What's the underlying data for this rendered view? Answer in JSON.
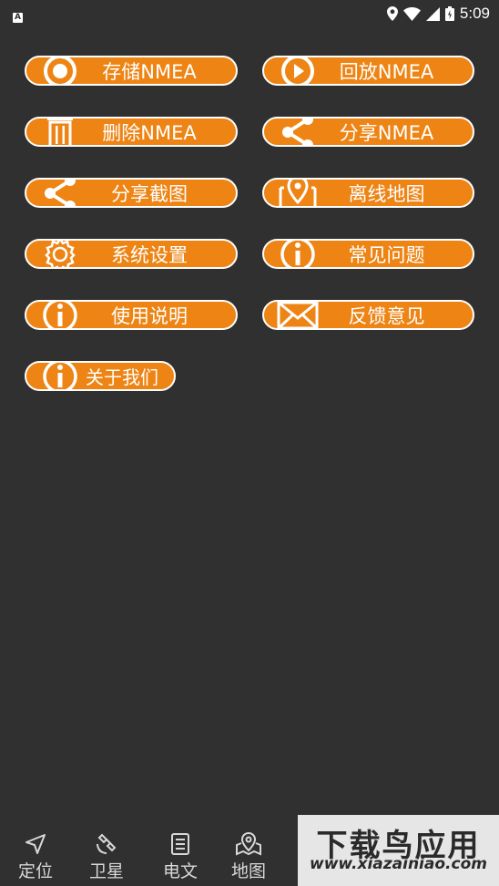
{
  "status_bar": {
    "time": "5:09",
    "app_badge": "A"
  },
  "menu": {
    "items": [
      {
        "label": "存储NMEA",
        "icon": "record-icon"
      },
      {
        "label": "回放NMEA",
        "icon": "play-icon"
      },
      {
        "label": "删除NMEA",
        "icon": "trash-icon"
      },
      {
        "label": "分享NMEA",
        "icon": "share-icon"
      },
      {
        "label": "分享截图",
        "icon": "share-icon"
      },
      {
        "label": "离线地图",
        "icon": "map-pin-icon"
      },
      {
        "label": "系统设置",
        "icon": "gear-icon"
      },
      {
        "label": "常见问题",
        "icon": "info-icon"
      },
      {
        "label": "使用说明",
        "icon": "info-icon"
      },
      {
        "label": "反馈意见",
        "icon": "mail-icon"
      },
      {
        "label": "关于我们",
        "icon": "info-icon"
      }
    ]
  },
  "bottom_nav": {
    "items": [
      {
        "label": "定位",
        "icon": "navigation-arrow-icon"
      },
      {
        "label": "卫星",
        "icon": "satellite-icon"
      },
      {
        "label": "电文",
        "icon": "document-icon"
      },
      {
        "label": "地图",
        "icon": "map-icon"
      }
    ]
  },
  "watermark": {
    "title": "下载鸟应用",
    "url": "www.xiazainiao.com"
  },
  "colors": {
    "background": "#303030",
    "accent": "#ed8414",
    "text": "#ffffff"
  }
}
